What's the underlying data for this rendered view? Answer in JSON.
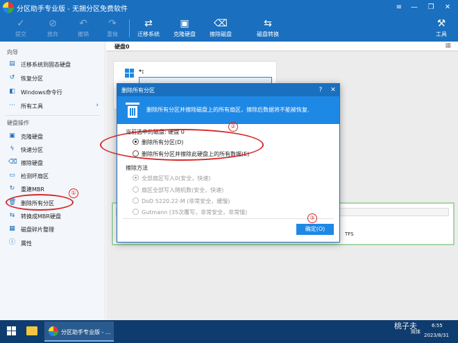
{
  "window": {
    "title": "分区助手专业版 - 无捆分区免费软件",
    "controls": [
      "≡",
      "—",
      "❐",
      "✕"
    ]
  },
  "toolbar": {
    "items": [
      {
        "label": "提交",
        "icon": "check-icon",
        "enabled": false
      },
      {
        "label": "放弃",
        "icon": "cancel-icon",
        "enabled": false
      },
      {
        "label": "撤销",
        "icon": "undo-icon",
        "enabled": false
      },
      {
        "label": "重做",
        "icon": "redo-icon",
        "enabled": false
      },
      {
        "label": "迁移系统",
        "icon": "migrate-icon",
        "enabled": true
      },
      {
        "label": "克隆硬盘",
        "icon": "clone-icon",
        "enabled": true
      },
      {
        "label": "擦除磁盘",
        "icon": "wipe-icon",
        "enabled": true
      },
      {
        "label": "磁盘转换",
        "icon": "convert-icon",
        "enabled": true
      }
    ],
    "tools_label": "工具"
  },
  "sidebar": {
    "wizard_title": "向导",
    "wizard_items": [
      {
        "label": "迁移系统到固态硬盘"
      },
      {
        "label": "恢复分区"
      },
      {
        "label": "Windows命令行"
      },
      {
        "label": "所有工具",
        "arrow": "›"
      }
    ],
    "disk_title": "硬盘操作",
    "disk_items": [
      {
        "label": "克隆硬盘"
      },
      {
        "label": "快速分区"
      },
      {
        "label": "擦除硬盘"
      },
      {
        "label": "检测坏扇区"
      },
      {
        "label": "重建MBR"
      },
      {
        "label": "删除所有分区"
      },
      {
        "label": "转换成MBR硬盘"
      },
      {
        "label": "磁盘碎片整理"
      },
      {
        "label": "属性"
      }
    ]
  },
  "main": {
    "disk_label": "硬盘0",
    "partition_label": "*:",
    "ntfs_label": "TFS"
  },
  "dialog": {
    "title": "删除所有分区",
    "help": "?",
    "close": "✕",
    "banner_text": "删除所有分区并擦除磁盘上的所有扇区，擦除后数据将不能被恢复.",
    "selected_disk_label": "当前选中的磁盘: 硬盘 0",
    "option_delete": "删除所有分区(D)",
    "option_delete_wipe": "删除所有分区并擦除此硬盘上的所有数据(E)",
    "wipe_method_label": "擦除方法",
    "wipe_methods": [
      "全部扇区写入0(安全，快速)",
      "扇区全部写入随机数(安全，快速)",
      "DoD 5220.22-M (非常安全，缓慢)",
      "Gutmann (35次覆写，非常安全，非常慢)"
    ],
    "ok_label": "确定(O)"
  },
  "annotations": {
    "n1": "①",
    "n2": "②",
    "n3": "③",
    "color": "#d62828"
  },
  "taskbar": {
    "task_label": "分区助手专业版 - ...",
    "watermark": "桃子夫",
    "ime": "简体",
    "time": "6:55",
    "date": "2023/8/31"
  }
}
